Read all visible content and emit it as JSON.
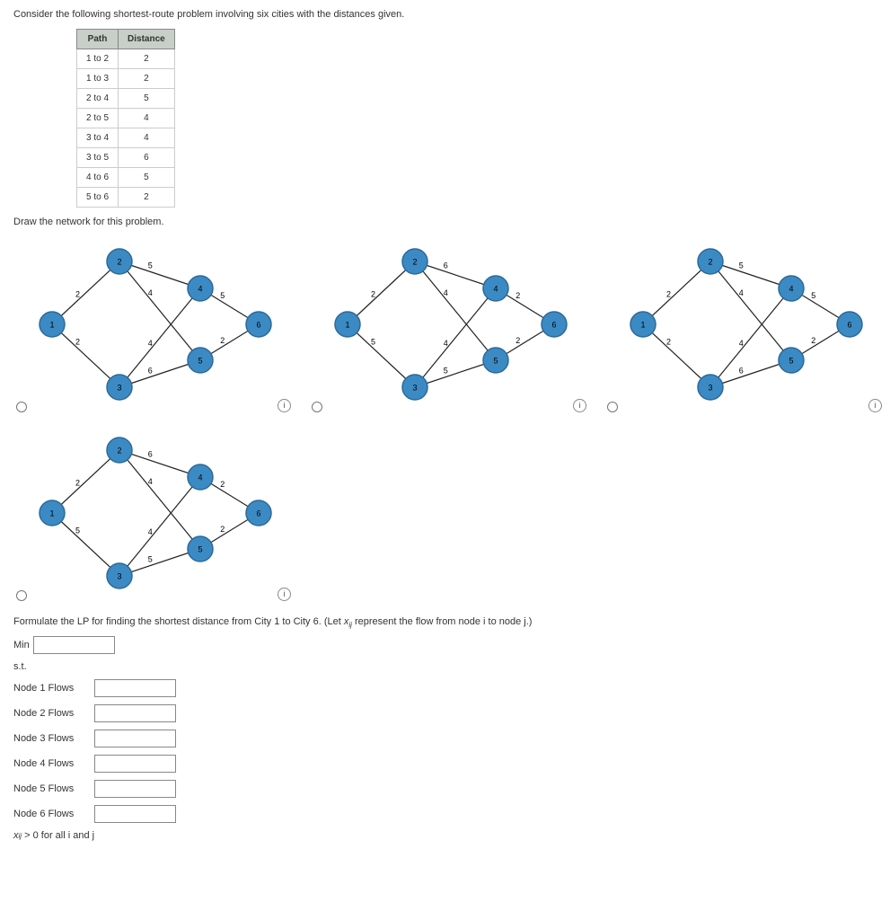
{
  "problem_statement": "Consider the following shortest-route problem involving six cities with the distances given.",
  "table": {
    "headers": [
      "Path",
      "Distance"
    ],
    "rows": [
      [
        "1 to 2",
        "2"
      ],
      [
        "1 to 3",
        "2"
      ],
      [
        "2 to 4",
        "5"
      ],
      [
        "2 to 5",
        "4"
      ],
      [
        "3 to 4",
        "4"
      ],
      [
        "3 to 5",
        "6"
      ],
      [
        "4 to 6",
        "5"
      ],
      [
        "5 to 6",
        "2"
      ]
    ]
  },
  "draw_prompt": "Draw the network for this problem.",
  "diagrams": {
    "nodes": [
      "1",
      "2",
      "3",
      "4",
      "5",
      "6"
    ],
    "option_a": {
      "edges": [
        {
          "from": "1",
          "to": "2",
          "w": "2"
        },
        {
          "from": "1",
          "to": "3",
          "w": "2"
        },
        {
          "from": "2",
          "to": "4",
          "w": "5"
        },
        {
          "from": "2",
          "to": "5",
          "w": "4"
        },
        {
          "from": "3",
          "to": "4",
          "w": "4"
        },
        {
          "from": "3",
          "to": "5",
          "w": "6"
        },
        {
          "from": "4",
          "to": "6",
          "w": "5"
        },
        {
          "from": "5",
          "to": "6",
          "w": "2"
        }
      ]
    },
    "option_b": {
      "edges": [
        {
          "from": "1",
          "to": "2",
          "w": "2"
        },
        {
          "from": "1",
          "to": "3",
          "w": "5"
        },
        {
          "from": "2",
          "to": "4",
          "w": "6"
        },
        {
          "from": "2",
          "to": "5",
          "w": "4"
        },
        {
          "from": "3",
          "to": "4",
          "w": "4"
        },
        {
          "from": "3",
          "to": "5",
          "w": "5"
        },
        {
          "from": "4",
          "to": "6",
          "w": "2"
        },
        {
          "from": "5",
          "to": "6",
          "w": "2"
        }
      ]
    },
    "option_c": {
      "edges": [
        {
          "from": "1",
          "to": "2",
          "w": "2"
        },
        {
          "from": "1",
          "to": "3",
          "w": "2"
        },
        {
          "from": "2",
          "to": "4",
          "w": "5"
        },
        {
          "from": "2",
          "to": "5",
          "w": "4"
        },
        {
          "from": "3",
          "to": "4",
          "w": "4"
        },
        {
          "from": "3",
          "to": "5",
          "w": "6"
        },
        {
          "from": "4",
          "to": "6",
          "w": "5"
        },
        {
          "from": "5",
          "to": "6",
          "w": "2"
        }
      ]
    },
    "option_d": {
      "edges": [
        {
          "from": "1",
          "to": "2",
          "w": "2"
        },
        {
          "from": "1",
          "to": "3",
          "w": "5"
        },
        {
          "from": "2",
          "to": "4",
          "w": "6"
        },
        {
          "from": "2",
          "to": "5",
          "w": "4"
        },
        {
          "from": "3",
          "to": "4",
          "w": "4"
        },
        {
          "from": "3",
          "to": "5",
          "w": "5"
        },
        {
          "from": "4",
          "to": "6",
          "w": "2"
        },
        {
          "from": "5",
          "to": "6",
          "w": "2"
        }
      ]
    }
  },
  "lp": {
    "prompt_before": "Formulate the LP for finding the shortest distance from City 1 to City 6. (Let ",
    "prompt_var": "x",
    "prompt_sub": "ij",
    "prompt_after": " represent the flow from node i to node j.)",
    "min_label": "Min",
    "st_label": "s.t.",
    "rows": [
      "Node 1 Flows",
      "Node 2 Flows",
      "Node 3 Flows",
      "Node 4 Flows",
      "Node 5 Flows",
      "Node 6 Flows"
    ],
    "nonneg_before": "x",
    "nonneg_sub": "ij",
    "nonneg_after": " > 0 for all i and j"
  }
}
